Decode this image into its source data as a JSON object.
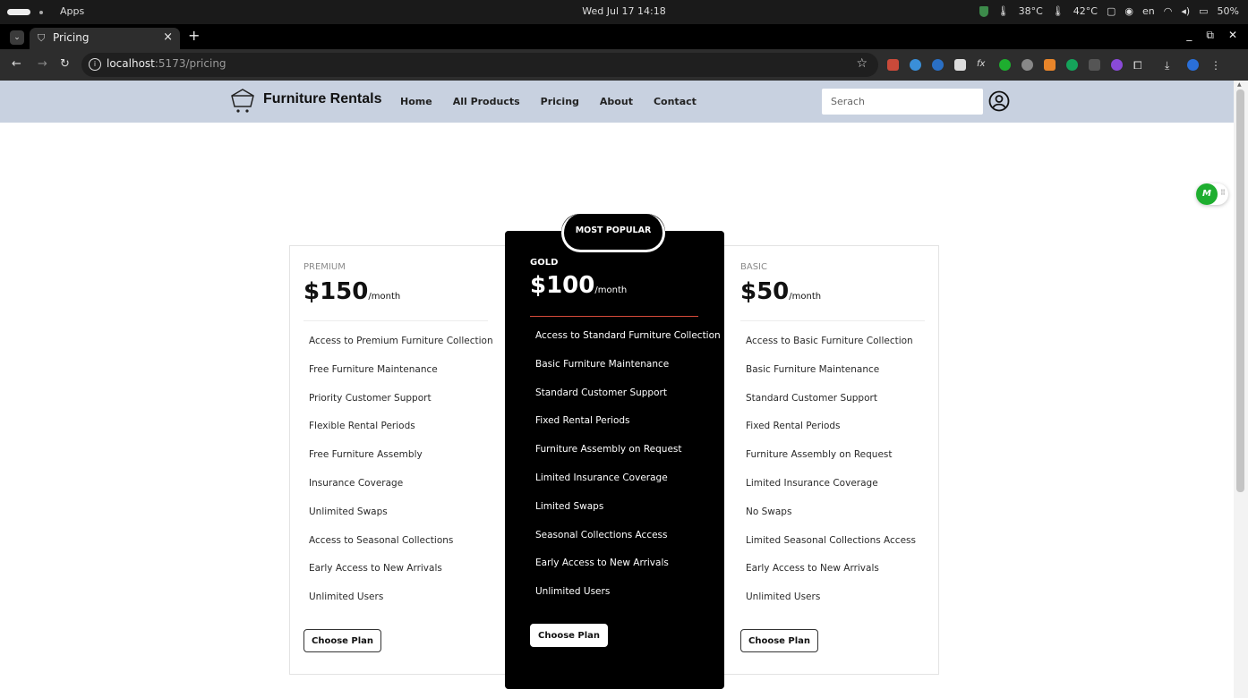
{
  "os": {
    "apps_label": "Apps",
    "clock": "Wed Jul 17  14:18",
    "temp1": "38°C",
    "temp2": "42°C",
    "lang": "en",
    "battery": "50%"
  },
  "browser": {
    "tab_title": "Pricing",
    "url_host": "localhost",
    "url_path": ":5173/pricing"
  },
  "site": {
    "brand": "Furniture Rentals",
    "nav": [
      "Home",
      "All Products",
      "Pricing",
      "About",
      "Contact"
    ],
    "search_placeholder": "Serach"
  },
  "widget": {
    "label": "M"
  },
  "pricing": {
    "badge": "MOST POPULAR",
    "plans": [
      {
        "tier": "PREMIUM",
        "price": "$150",
        "period": "/month",
        "features": [
          "Access to Premium Furniture Collection",
          "Free Furniture Maintenance",
          "Priority Customer Support",
          "Flexible Rental Periods",
          "Free Furniture Assembly",
          "Insurance Coverage",
          "Unlimited Swaps",
          "Access to Seasonal Collections",
          "Early Access to New Arrivals",
          "Unlimited Users"
        ],
        "button": "Choose Plan"
      },
      {
        "tier": "GOLD",
        "price": "$100",
        "period": "/month",
        "features": [
          "Access to Standard Furniture Collection",
          "Basic Furniture Maintenance",
          "Standard Customer Support",
          "Fixed Rental Periods",
          "Furniture Assembly on Request",
          "Limited Insurance Coverage",
          "Limited Swaps",
          "Seasonal Collections Access",
          "Early Access to New Arrivals",
          "Unlimited Users"
        ],
        "button": "Choose Plan"
      },
      {
        "tier": "BASIC",
        "price": "$50",
        "period": "/month",
        "features": [
          "Access to Basic Furniture Collection",
          "Basic Furniture Maintenance",
          "Standard Customer Support",
          "Fixed Rental Periods",
          "Furniture Assembly on Request",
          "Limited Insurance Coverage",
          "No Swaps",
          "Limited Seasonal Collections Access",
          "Early Access to New Arrivals",
          "Unlimited Users"
        ],
        "button": "Choose Plan"
      }
    ]
  }
}
